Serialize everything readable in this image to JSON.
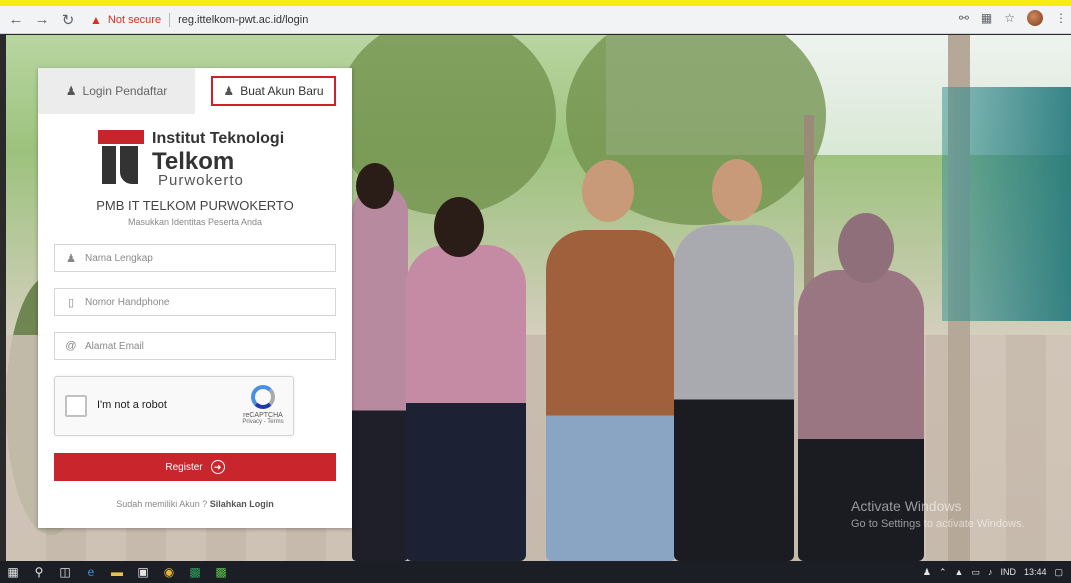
{
  "browser": {
    "not_secure_label": "Not secure",
    "url": "reg.ittelkom-pwt.ac.id/login"
  },
  "tabs": [
    {
      "label": "Login Pendaftar",
      "icon": "user-icon",
      "active": false
    },
    {
      "label": "Buat Akun Baru",
      "icon": "user-add-icon",
      "active": true
    }
  ],
  "logo": {
    "line1": "Institut Teknologi",
    "line2": "Telkom",
    "line3": "Purwokerto"
  },
  "form": {
    "title": "PMB IT TELKOM PURWOKERTO",
    "subtitle": "Masukkan Identitas Peserta Anda",
    "name_placeholder": "Nama Lengkap",
    "phone_placeholder": "Nomor Handphone",
    "email_placeholder": "Alamat Email",
    "captcha_label": "I'm not a robot",
    "captcha_brand": "reCAPTCHA",
    "captcha_links": "Privacy - Terms",
    "register_label": "Register",
    "already_text": "Sudah memiliki Akun ?",
    "login_link": "Silahkan Login"
  },
  "watermark": {
    "line1": "Activate Windows",
    "line2": "Go to Settings to activate Windows."
  },
  "taskbar": {
    "language": "IND",
    "time": "13:44"
  },
  "colors": {
    "accent": "#c8252c",
    "highlight_border": "#d0202a"
  }
}
